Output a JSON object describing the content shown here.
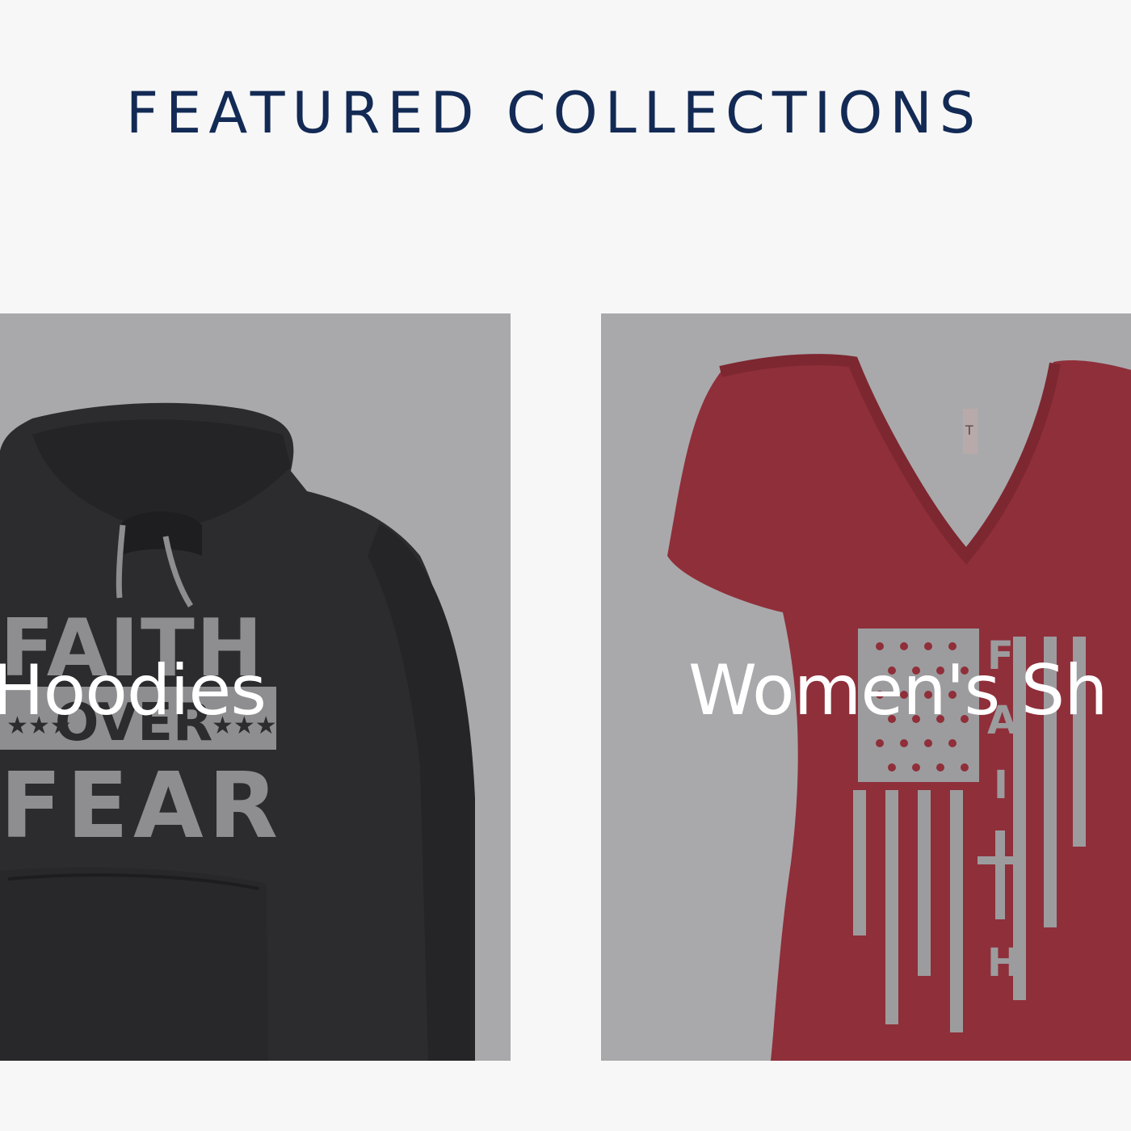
{
  "section": {
    "title": "FEATURED COLLECTIONS"
  },
  "collections": [
    {
      "label": "Hoodies",
      "print": {
        "line1": "FAITH",
        "line2": "OVER",
        "line3": "FEAR"
      }
    },
    {
      "label": "Women's Sh",
      "print": {
        "word": "FAITH"
      }
    }
  ],
  "colors": {
    "title": "#132a55",
    "background": "#f7f7f7",
    "card_background": "#a9a9ab",
    "hoodie": "#2c2c2e",
    "shirt": "#8f2f3a"
  }
}
